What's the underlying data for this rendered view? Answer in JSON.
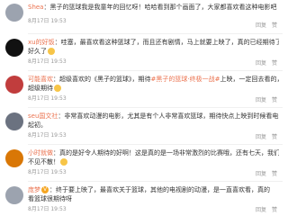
{
  "comments": [
    {
      "user": "Shea",
      "line1": "：黑子的篮球我是我童年的回忆呀！哈哈看到那个画面了，大家都喜欢看这种电影吧",
      "line2": "",
      "time": "8月17日 19:53",
      "actions": [
        "回复",
        "赞"
      ],
      "avatar_color": "#9ca3af"
    },
    {
      "user": "xu的好饭",
      "line1": "：哇塞，最喜欢看这种篮球了，而且还有剧情，马上就要上映了，真的已经期待了",
      "line2": "好久了",
      "time": "8月17日 19:53",
      "actions": [
        "回复",
        "赞"
      ],
      "avatar_color": "#111111"
    },
    {
      "user": "可能喜欢",
      "line1": "：超级喜欢的《黑子的篮球》，期待",
      "topic": "#黑子的篮球·终极一战#",
      "line1b": "上映，一定回去看的，",
      "line2": "超级期待",
      "time": "8月17日 19:53",
      "actions": [
        "回复",
        "赞"
      ],
      "avatar_color": "#c13d3d"
    },
    {
      "user": "seu国文社",
      "line1": "：非常喜欢动漫的电影，尤其是有个人非常喜欢篮球，期待快点上映到时候看电影再到的",
      "line2": "起初。",
      "time": "8月17日 19:53",
      "actions": [
        "回复",
        "赞"
      ],
      "avatar_color": "#6b7280"
    },
    {
      "user": "小时就做",
      "line1": "：真的是好令人期待的好啊！这是真的是一场非常激烈的比赛哦，还有七天，我们都",
      "line2": "不见不散！",
      "time": "8月17日 19:53",
      "actions": [
        "回复",
        "赞"
      ],
      "avatar_color": "#d97706"
    },
    {
      "user": "庞梦",
      "line1": "：终于要上映了，最喜欢关于篮球，其他的电视剧的动漫，是一直喜欢看，真的",
      "line2": "看篮球很期待呀",
      "time": "8月17日 19:53",
      "actions": [
        "回复",
        "赞"
      ],
      "avatar_color": "#9ca3af"
    }
  ]
}
